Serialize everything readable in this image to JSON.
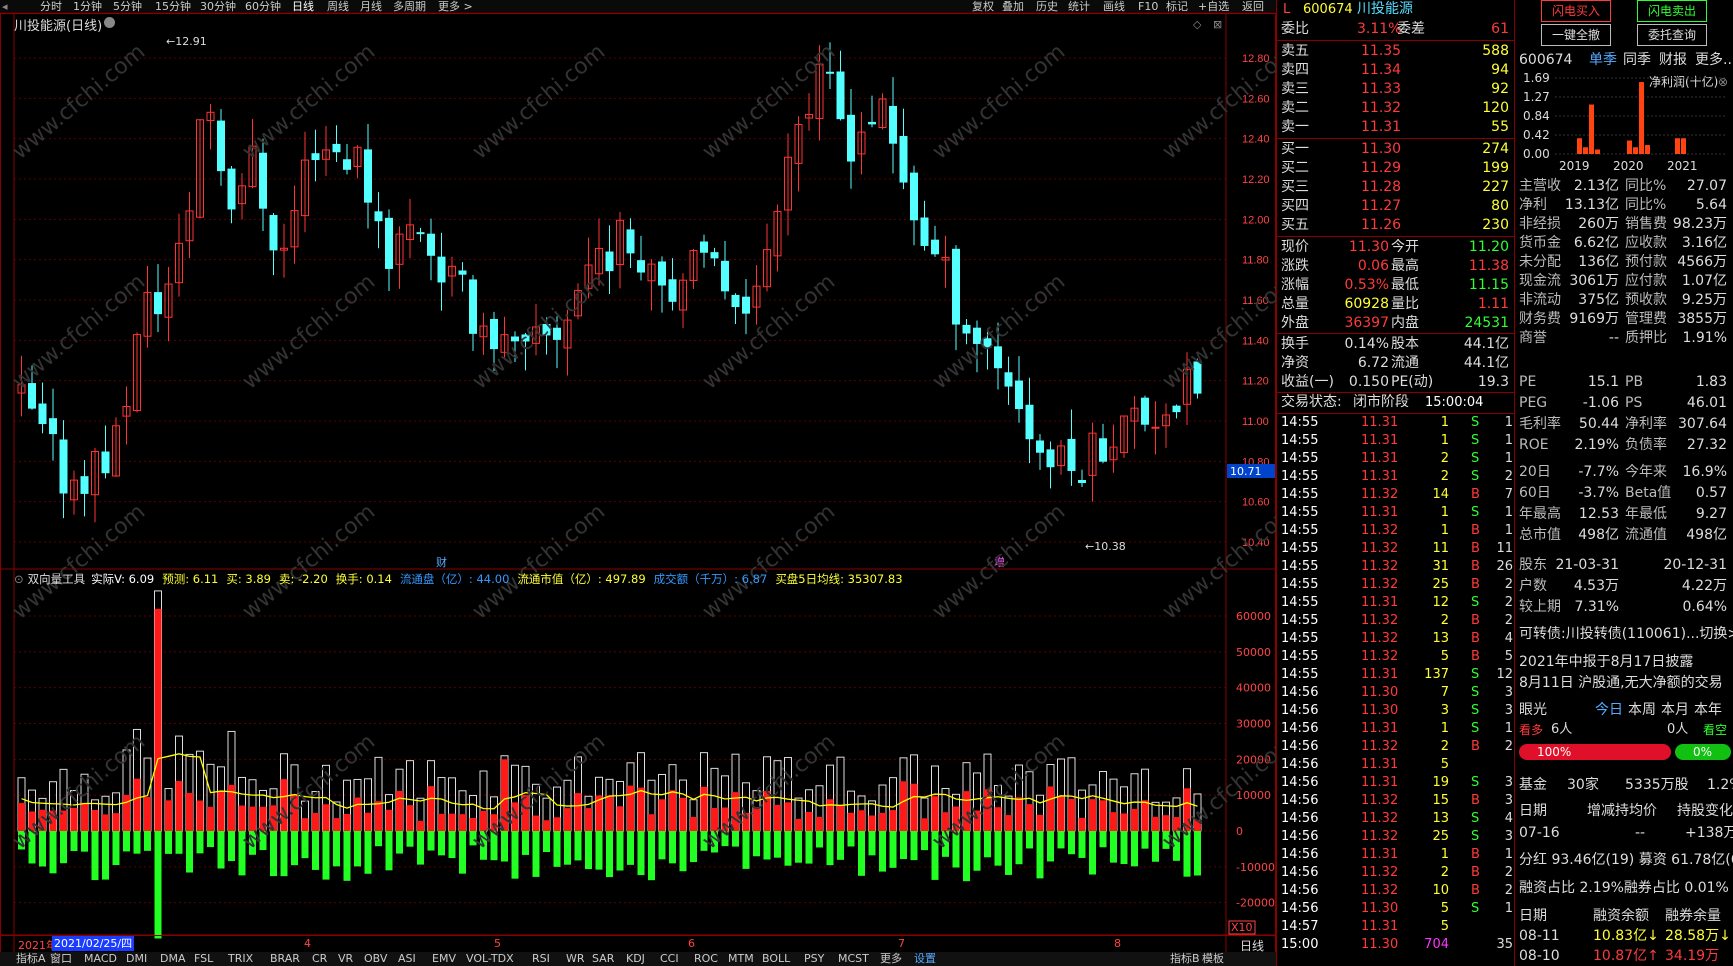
{
  "toolbar": {
    "periods": [
      "分时",
      "1分钟",
      "5分钟",
      "15分钟",
      "30分钟",
      "60分钟",
      "日线",
      "周线",
      "月线",
      "多周期",
      "更多 >"
    ],
    "selected_period": "日线",
    "right_tools": [
      "复权",
      "叠加",
      "历史",
      "统计",
      "画线",
      "F10",
      "标记",
      "+自选",
      "返回"
    ]
  },
  "kchart": {
    "title": "川投能源(日线)",
    "y_ticks": [
      "12.80",
      "12.60",
      "12.40",
      "12.20",
      "12.00",
      "11.80",
      "11.60",
      "11.40",
      "11.20",
      "11.00",
      "10.80",
      "10.60",
      "10.40"
    ],
    "high_label": "12.91",
    "low_label": "10.38",
    "current_price_tag": "10.71",
    "marker_cai": "财",
    "marker_zeng": "增"
  },
  "indicator": {
    "header": "双向量工具",
    "items": [
      {
        "label": "实际V: 6.09",
        "color": "#ffffff"
      },
      {
        "label": "预测: 6.11",
        "color": "#ffff33"
      },
      {
        "label": "买: 3.89",
        "color": "#ffff33"
      },
      {
        "label": "卖: -2.20",
        "color": "#ffff33"
      },
      {
        "label": "换手: 0.14",
        "color": "#ffff33"
      },
      {
        "label": "流通盘（亿）: 44.00",
        "color": "#3399ff"
      },
      {
        "label": "流通市值（亿）: 497.89",
        "color": "#ffff33"
      },
      {
        "label": "成交额（千万）: 6.87",
        "color": "#3399ff"
      },
      {
        "label": "买盘5日均线: 35307.83",
        "color": "#ffff33"
      }
    ],
    "y_ticks": [
      "60000",
      "50000",
      "40000",
      "30000",
      "20000",
      "10000",
      "0",
      "-10000",
      "-20000"
    ],
    "unit_tag": "X10"
  },
  "date_axis": {
    "start_label": "2021年",
    "cursor_date": "2021/02/25/四",
    "months": [
      "4",
      "5",
      "6",
      "7",
      "8"
    ],
    "period_label": "日线"
  },
  "bottom_tabs": [
    "指标A",
    "窗口",
    "MACD",
    "DMI",
    "DMA",
    "FSL",
    "TRIX",
    "BRAR",
    "CR",
    "VR",
    "OBV",
    "ASI",
    "EMV",
    "VOL-TDX",
    "RSI",
    "WR",
    "SAR",
    "KDJ",
    "CCI",
    "ROC",
    "MTM",
    "BOLL",
    "PSY",
    "MCST",
    "更多",
    "设置"
  ],
  "bottom_right": [
    "指标B",
    "模板"
  ],
  "quote": {
    "code": "600674",
    "name": "川投能源",
    "weibi": {
      "label": "委比",
      "pct": "3.11%",
      "label2": "委差",
      "val": "61"
    },
    "sells": [
      {
        "label": "卖五",
        "price": "11.35",
        "vol": "588"
      },
      {
        "label": "卖四",
        "price": "11.34",
        "vol": "94"
      },
      {
        "label": "卖三",
        "price": "11.33",
        "vol": "92"
      },
      {
        "label": "卖二",
        "price": "11.32",
        "vol": "120"
      },
      {
        "label": "卖一",
        "price": "11.31",
        "vol": "55"
      }
    ],
    "buys": [
      {
        "label": "买一",
        "price": "11.30",
        "vol": "274"
      },
      {
        "label": "买二",
        "price": "11.29",
        "vol": "199"
      },
      {
        "label": "买三",
        "price": "11.28",
        "vol": "227"
      },
      {
        "label": "买四",
        "price": "11.27",
        "vol": "80"
      },
      {
        "label": "买五",
        "price": "11.26",
        "vol": "230"
      }
    ],
    "stats": [
      {
        "l1": "现价",
        "v1": "11.30",
        "l2": "今开",
        "v2": "11.20",
        "c1": "r",
        "c2": "g"
      },
      {
        "l1": "涨跌",
        "v1": "0.06",
        "l2": "最高",
        "v2": "11.38",
        "c1": "r",
        "c2": "r"
      },
      {
        "l1": "涨幅",
        "v1": "0.53%",
        "l2": "最低",
        "v2": "11.15",
        "c1": "r",
        "c2": "g"
      },
      {
        "l1": "总量",
        "v1": "60928",
        "l2": "量比",
        "v2": "1.11",
        "c1": "y",
        "c2": "r"
      },
      {
        "l1": "外盘",
        "v1": "36397",
        "l2": "内盘",
        "v2": "24531",
        "c1": "r",
        "c2": "g"
      }
    ],
    "stats2": [
      {
        "l1": "换手",
        "v1": "0.14%",
        "l2": "股本",
        "v2": "44.1亿"
      },
      {
        "l1": "净资",
        "v1": "6.72",
        "l2": "流通",
        "v2": "44.1亿"
      },
      {
        "l1": "收益(一)",
        "v1": "0.150",
        "l2": "PE(动)",
        "v2": "19.3"
      }
    ],
    "status": {
      "label": "交易状态:",
      "value": "闭市阶段",
      "time": "15:00:04"
    },
    "ticks": [
      [
        "14:55",
        "11.31",
        "1",
        "S",
        "1"
      ],
      [
        "14:55",
        "11.31",
        "1",
        "S",
        "1"
      ],
      [
        "14:55",
        "11.31",
        "2",
        "S",
        "1"
      ],
      [
        "14:55",
        "11.31",
        "2",
        "S",
        "2"
      ],
      [
        "14:55",
        "11.32",
        "14",
        "B",
        "7"
      ],
      [
        "14:55",
        "11.31",
        "1",
        "S",
        "1"
      ],
      [
        "14:55",
        "11.32",
        "1",
        "B",
        "1"
      ],
      [
        "14:55",
        "11.32",
        "11",
        "B",
        "11"
      ],
      [
        "14:55",
        "11.32",
        "31",
        "B",
        "26"
      ],
      [
        "14:55",
        "11.32",
        "25",
        "B",
        "2"
      ],
      [
        "14:55",
        "11.31",
        "12",
        "S",
        "2"
      ],
      [
        "14:55",
        "11.32",
        "2",
        "B",
        "2"
      ],
      [
        "14:55",
        "11.32",
        "13",
        "B",
        "4"
      ],
      [
        "14:55",
        "11.32",
        "5",
        "B",
        "5"
      ],
      [
        "14:55",
        "11.31",
        "137",
        "S",
        "12"
      ],
      [
        "14:56",
        "11.30",
        "7",
        "S",
        "3"
      ],
      [
        "14:56",
        "11.30",
        "3",
        "S",
        "3"
      ],
      [
        "14:56",
        "11.31",
        "1",
        "S",
        "1"
      ],
      [
        "14:56",
        "11.32",
        "2",
        "B",
        "2"
      ],
      [
        "14:56",
        "11.31",
        "5",
        "",
        ""
      ],
      [
        "14:56",
        "11.31",
        "19",
        "S",
        "3"
      ],
      [
        "14:56",
        "11.32",
        "15",
        "B",
        "3"
      ],
      [
        "14:56",
        "11.32",
        "13",
        "S",
        "4"
      ],
      [
        "14:56",
        "11.32",
        "25",
        "S",
        "3"
      ],
      [
        "14:56",
        "11.31",
        "1",
        "B",
        "1"
      ],
      [
        "14:56",
        "11.32",
        "2",
        "B",
        "2"
      ],
      [
        "14:56",
        "11.32",
        "10",
        "B",
        "2"
      ],
      [
        "14:56",
        "11.30",
        "5",
        "S",
        "1"
      ],
      [
        "14:57",
        "11.31",
        "5",
        "",
        ""
      ],
      [
        "15:00",
        "11.30",
        "704",
        "",
        "35"
      ]
    ]
  },
  "f10": {
    "buttons": {
      "flash_buy": "闪电买入",
      "flash_sell": "闪电卖出",
      "cancel_all": "一键全撤",
      "order_query": "委托查询"
    },
    "tabs": [
      "600674",
      "单季",
      "同季",
      "财报",
      "更多.."
    ],
    "chart_title": "净利润(十亿)",
    "chart_y": [
      "1.69",
      "1.27",
      "0.84",
      "0.42",
      "0.00"
    ],
    "chart_years": [
      "2019",
      "2020",
      "2021"
    ],
    "chart_data": {
      "type": "bar",
      "title": "净利润(十亿)",
      "ylim": [
        0,
        1.69
      ],
      "categories": [
        "2019-Q1",
        "2019-Q2",
        "2019-Q3",
        "2019-Q4",
        "2020-Q1",
        "2020-Q2",
        "2020-Q3",
        "2020-Q4",
        "2021-Q1",
        "2021-Q2"
      ],
      "values": [
        0.35,
        0.15,
        1.1,
        0.1,
        0.3,
        0.15,
        1.6,
        0.2,
        0.35,
        0.35
      ]
    },
    "fin": [
      [
        "主营收",
        "2.13亿",
        "同比%",
        "27.07"
      ],
      [
        "净利",
        "13.13亿",
        "同比%",
        "5.64"
      ],
      [
        "非经损",
        "260万",
        "销售费",
        "98.23万"
      ],
      [
        "货币金",
        "6.62亿",
        "应收款",
        "3.16亿"
      ],
      [
        "未分配",
        "136亿",
        "预付款",
        "4566万"
      ],
      [
        "现金流",
        "3061万",
        "应付款",
        "1.07亿"
      ],
      [
        "非流动",
        "375亿",
        "预收款",
        "9.25万"
      ],
      [
        "财务费",
        "9169万",
        "管理费",
        "3855万"
      ],
      [
        "商誉",
        "--",
        "质押比",
        "1.91%"
      ]
    ],
    "val": [
      [
        "PE",
        "15.1",
        "PB",
        "1.83"
      ],
      [
        "PEG",
        "-1.06",
        "PS",
        "46.01"
      ],
      [
        "毛利率",
        "50.44",
        "净利率",
        "307.64"
      ],
      [
        "ROE",
        "2.19%",
        "负债率",
        "27.32"
      ]
    ],
    "perf": [
      [
        "20日",
        "-7.7%",
        "今年来",
        "16.9%"
      ],
      [
        "60日",
        "-3.7%",
        "Beta值",
        "0.57"
      ],
      [
        "年最高",
        "12.53",
        "年最低",
        "9.27"
      ],
      [
        "总市值",
        "498亿",
        "流通值",
        "498亿"
      ]
    ],
    "holders": [
      [
        "股东",
        "21-03-31",
        "",
        "20-12-31"
      ],
      [
        "户数",
        "4.53万",
        "",
        "4.22万"
      ],
      [
        "较上期",
        "7.31%",
        "",
        "0.64%"
      ]
    ],
    "bond": "可转债:川投转债(110061)...切换>",
    "news1": "2021年中报于8月17日披露",
    "news2": "8月11日 沪股通,无大净额的交易",
    "eye": {
      "label": "眼光",
      "tabs": [
        "今日",
        "本周",
        "本月",
        "本年"
      ],
      "bull": "看多",
      "bull_n": "6人",
      "bear_n": "0人",
      "bear": "看空",
      "bull_pct": "100%",
      "bear_pct": "0%"
    },
    "fund": {
      "label": "基金",
      "n": "30家",
      "shares": "5335万股",
      "pct": "1.2%"
    },
    "fund_hdr": [
      "日期",
      "增减持均价",
      "持股变化"
    ],
    "fund_row": [
      "07-16",
      "--",
      "+138万"
    ],
    "div": "分红 93.46亿(19) 募资 61.78亿(6)",
    "margin": "融资占比 2.19%融券占比 0.01%",
    "margin_hdr": [
      "日期",
      "融资余额",
      "融券余量"
    ],
    "margin_rows": [
      [
        "08-11",
        "10.83亿↓",
        "28.58万↓"
      ],
      [
        "08-10",
        "10.87亿↑",
        "34.19万"
      ]
    ]
  },
  "colors": {
    "up": "#ff3333",
    "down": "#54ffff",
    "bg": "#000000",
    "grid": "#8a0000",
    "vol_buy": "#ff1a1a",
    "vol_sell": "#22ff22",
    "ma": "#ffff00"
  }
}
